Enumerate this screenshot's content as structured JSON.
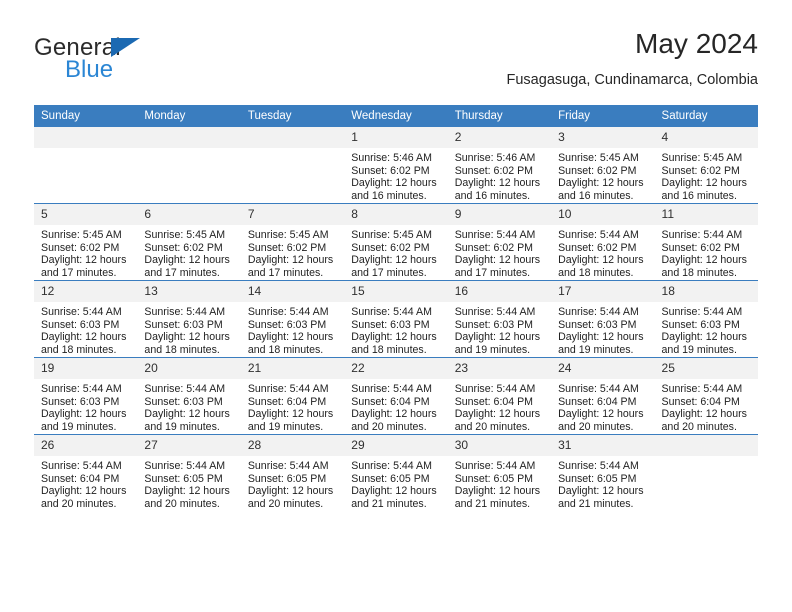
{
  "brand": {
    "name_part1": "General",
    "name_part2": "Blue"
  },
  "header": {
    "title": "May 2024",
    "subtitle": "Fusagasuga, Cundinamarca, Colombia"
  },
  "colors": {
    "header_blue": "#3a7dbf",
    "logo_blue": "#2b86d4",
    "daynum_band": "#f2f2f2"
  },
  "weekdays": [
    "Sunday",
    "Monday",
    "Tuesday",
    "Wednesday",
    "Thursday",
    "Friday",
    "Saturday"
  ],
  "weeks": [
    [
      {
        "day": "",
        "sunrise": "",
        "sunset": "",
        "daylight1": "",
        "daylight2": ""
      },
      {
        "day": "",
        "sunrise": "",
        "sunset": "",
        "daylight1": "",
        "daylight2": ""
      },
      {
        "day": "",
        "sunrise": "",
        "sunset": "",
        "daylight1": "",
        "daylight2": ""
      },
      {
        "day": "1",
        "sunrise": "Sunrise: 5:46 AM",
        "sunset": "Sunset: 6:02 PM",
        "daylight1": "Daylight: 12 hours",
        "daylight2": "and 16 minutes."
      },
      {
        "day": "2",
        "sunrise": "Sunrise: 5:46 AM",
        "sunset": "Sunset: 6:02 PM",
        "daylight1": "Daylight: 12 hours",
        "daylight2": "and 16 minutes."
      },
      {
        "day": "3",
        "sunrise": "Sunrise: 5:45 AM",
        "sunset": "Sunset: 6:02 PM",
        "daylight1": "Daylight: 12 hours",
        "daylight2": "and 16 minutes."
      },
      {
        "day": "4",
        "sunrise": "Sunrise: 5:45 AM",
        "sunset": "Sunset: 6:02 PM",
        "daylight1": "Daylight: 12 hours",
        "daylight2": "and 16 minutes."
      }
    ],
    [
      {
        "day": "5",
        "sunrise": "Sunrise: 5:45 AM",
        "sunset": "Sunset: 6:02 PM",
        "daylight1": "Daylight: 12 hours",
        "daylight2": "and 17 minutes."
      },
      {
        "day": "6",
        "sunrise": "Sunrise: 5:45 AM",
        "sunset": "Sunset: 6:02 PM",
        "daylight1": "Daylight: 12 hours",
        "daylight2": "and 17 minutes."
      },
      {
        "day": "7",
        "sunrise": "Sunrise: 5:45 AM",
        "sunset": "Sunset: 6:02 PM",
        "daylight1": "Daylight: 12 hours",
        "daylight2": "and 17 minutes."
      },
      {
        "day": "8",
        "sunrise": "Sunrise: 5:45 AM",
        "sunset": "Sunset: 6:02 PM",
        "daylight1": "Daylight: 12 hours",
        "daylight2": "and 17 minutes."
      },
      {
        "day": "9",
        "sunrise": "Sunrise: 5:44 AM",
        "sunset": "Sunset: 6:02 PM",
        "daylight1": "Daylight: 12 hours",
        "daylight2": "and 17 minutes."
      },
      {
        "day": "10",
        "sunrise": "Sunrise: 5:44 AM",
        "sunset": "Sunset: 6:02 PM",
        "daylight1": "Daylight: 12 hours",
        "daylight2": "and 18 minutes."
      },
      {
        "day": "11",
        "sunrise": "Sunrise: 5:44 AM",
        "sunset": "Sunset: 6:02 PM",
        "daylight1": "Daylight: 12 hours",
        "daylight2": "and 18 minutes."
      }
    ],
    [
      {
        "day": "12",
        "sunrise": "Sunrise: 5:44 AM",
        "sunset": "Sunset: 6:03 PM",
        "daylight1": "Daylight: 12 hours",
        "daylight2": "and 18 minutes."
      },
      {
        "day": "13",
        "sunrise": "Sunrise: 5:44 AM",
        "sunset": "Sunset: 6:03 PM",
        "daylight1": "Daylight: 12 hours",
        "daylight2": "and 18 minutes."
      },
      {
        "day": "14",
        "sunrise": "Sunrise: 5:44 AM",
        "sunset": "Sunset: 6:03 PM",
        "daylight1": "Daylight: 12 hours",
        "daylight2": "and 18 minutes."
      },
      {
        "day": "15",
        "sunrise": "Sunrise: 5:44 AM",
        "sunset": "Sunset: 6:03 PM",
        "daylight1": "Daylight: 12 hours",
        "daylight2": "and 18 minutes."
      },
      {
        "day": "16",
        "sunrise": "Sunrise: 5:44 AM",
        "sunset": "Sunset: 6:03 PM",
        "daylight1": "Daylight: 12 hours",
        "daylight2": "and 19 minutes."
      },
      {
        "day": "17",
        "sunrise": "Sunrise: 5:44 AM",
        "sunset": "Sunset: 6:03 PM",
        "daylight1": "Daylight: 12 hours",
        "daylight2": "and 19 minutes."
      },
      {
        "day": "18",
        "sunrise": "Sunrise: 5:44 AM",
        "sunset": "Sunset: 6:03 PM",
        "daylight1": "Daylight: 12 hours",
        "daylight2": "and 19 minutes."
      }
    ],
    [
      {
        "day": "19",
        "sunrise": "Sunrise: 5:44 AM",
        "sunset": "Sunset: 6:03 PM",
        "daylight1": "Daylight: 12 hours",
        "daylight2": "and 19 minutes."
      },
      {
        "day": "20",
        "sunrise": "Sunrise: 5:44 AM",
        "sunset": "Sunset: 6:03 PM",
        "daylight1": "Daylight: 12 hours",
        "daylight2": "and 19 minutes."
      },
      {
        "day": "21",
        "sunrise": "Sunrise: 5:44 AM",
        "sunset": "Sunset: 6:04 PM",
        "daylight1": "Daylight: 12 hours",
        "daylight2": "and 19 minutes."
      },
      {
        "day": "22",
        "sunrise": "Sunrise: 5:44 AM",
        "sunset": "Sunset: 6:04 PM",
        "daylight1": "Daylight: 12 hours",
        "daylight2": "and 20 minutes."
      },
      {
        "day": "23",
        "sunrise": "Sunrise: 5:44 AM",
        "sunset": "Sunset: 6:04 PM",
        "daylight1": "Daylight: 12 hours",
        "daylight2": "and 20 minutes."
      },
      {
        "day": "24",
        "sunrise": "Sunrise: 5:44 AM",
        "sunset": "Sunset: 6:04 PM",
        "daylight1": "Daylight: 12 hours",
        "daylight2": "and 20 minutes."
      },
      {
        "day": "25",
        "sunrise": "Sunrise: 5:44 AM",
        "sunset": "Sunset: 6:04 PM",
        "daylight1": "Daylight: 12 hours",
        "daylight2": "and 20 minutes."
      }
    ],
    [
      {
        "day": "26",
        "sunrise": "Sunrise: 5:44 AM",
        "sunset": "Sunset: 6:04 PM",
        "daylight1": "Daylight: 12 hours",
        "daylight2": "and 20 minutes."
      },
      {
        "day": "27",
        "sunrise": "Sunrise: 5:44 AM",
        "sunset": "Sunset: 6:05 PM",
        "daylight1": "Daylight: 12 hours",
        "daylight2": "and 20 minutes."
      },
      {
        "day": "28",
        "sunrise": "Sunrise: 5:44 AM",
        "sunset": "Sunset: 6:05 PM",
        "daylight1": "Daylight: 12 hours",
        "daylight2": "and 20 minutes."
      },
      {
        "day": "29",
        "sunrise": "Sunrise: 5:44 AM",
        "sunset": "Sunset: 6:05 PM",
        "daylight1": "Daylight: 12 hours",
        "daylight2": "and 21 minutes."
      },
      {
        "day": "30",
        "sunrise": "Sunrise: 5:44 AM",
        "sunset": "Sunset: 6:05 PM",
        "daylight1": "Daylight: 12 hours",
        "daylight2": "and 21 minutes."
      },
      {
        "day": "31",
        "sunrise": "Sunrise: 5:44 AM",
        "sunset": "Sunset: 6:05 PM",
        "daylight1": "Daylight: 12 hours",
        "daylight2": "and 21 minutes."
      },
      {
        "day": "",
        "sunrise": "",
        "sunset": "",
        "daylight1": "",
        "daylight2": ""
      }
    ]
  ]
}
